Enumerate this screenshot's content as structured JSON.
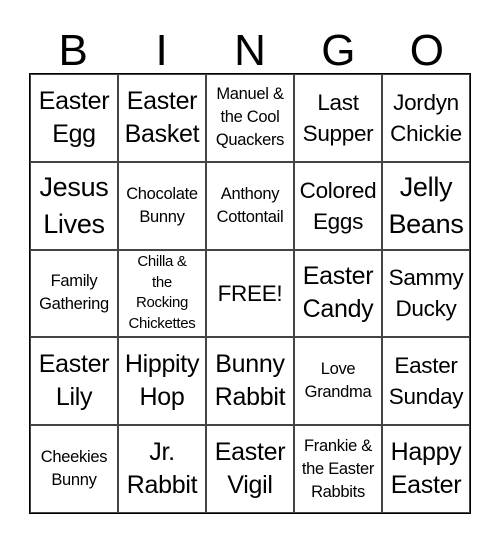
{
  "header": {
    "letters": [
      "B",
      "I",
      "N",
      "G",
      "O"
    ]
  },
  "cells": [
    [
      "Easter\nEgg",
      "Easter\nBasket",
      "Manuel &\nthe Cool\nQuackers",
      "Last\nSupper",
      "Jordyn\nChickie"
    ],
    [
      "Jesus\nLives",
      "Chocolate\nBunny",
      "Anthony\nCottontail",
      "Colored\nEggs",
      "Jelly\nBeans"
    ],
    [
      "Family\nGathering",
      "Chilla &\nthe\nRocking\nChickettes",
      "FREE!",
      "Easter\nCandy",
      "Sammy\nDucky"
    ],
    [
      "Easter\nLily",
      "Hippity\nHop",
      "Bunny\nRabbit",
      "Love\nGrandma",
      "Easter\nSunday"
    ],
    [
      "Cheekies\nBunny",
      "Jr.\nRabbit",
      "Easter\nVigil",
      "Frankie &\nthe Easter\nRabbits",
      "Happy\nEaster"
    ]
  ]
}
